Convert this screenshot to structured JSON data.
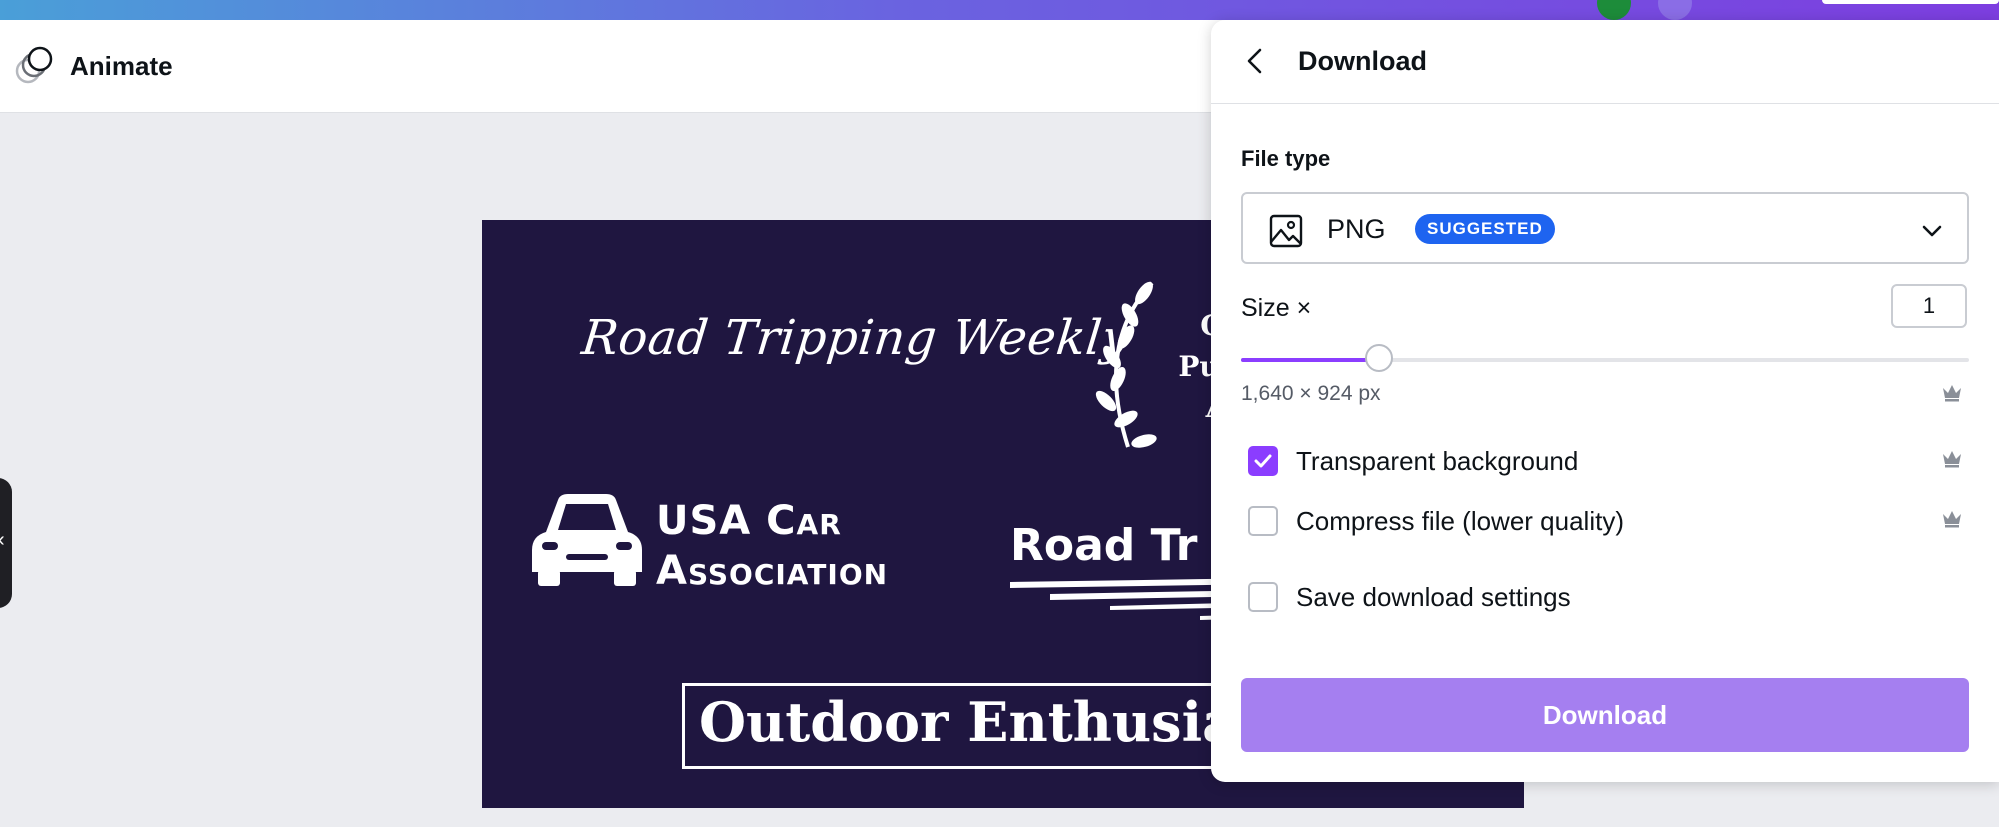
{
  "toolbar": {
    "animate_label": "Animate"
  },
  "design": {
    "script_title": "Road Tripping Weekly",
    "award_lines": [
      "Onl",
      "Public",
      "Aw"
    ],
    "usa_line1": "USA Car",
    "usa_line2": "Association",
    "road_trip_text": "Road Tr",
    "outdoor_text": "Outdoor Enthusiast"
  },
  "download_panel": {
    "title": "Download",
    "file_type_label": "File type",
    "file_type_value": "PNG",
    "suggested_badge": "SUGGESTED",
    "size_label": "Size ×",
    "size_value": "1",
    "size_slider_fraction": 0.19,
    "dimensions": "1,640 × 924 px",
    "options": [
      {
        "label": "Transparent background",
        "checked": true,
        "premium": true
      },
      {
        "label": "Compress file (lower quality)",
        "checked": false,
        "premium": true
      },
      {
        "label": "Save download settings",
        "checked": false,
        "premium": false
      }
    ],
    "download_button": "Download"
  },
  "colors": {
    "accent": "#8b3dff",
    "badge": "#1e64f0",
    "design_background": "#1f1640",
    "download_button": "#a57ff0"
  }
}
